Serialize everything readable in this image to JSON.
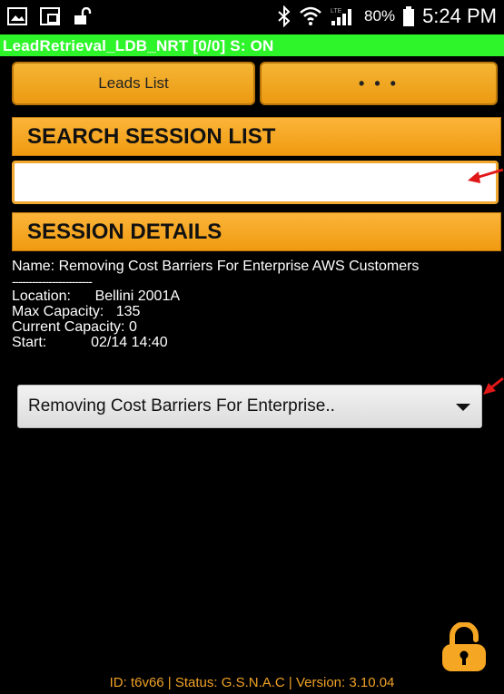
{
  "status_bar": {
    "left_icons": [
      "gallery-icon",
      "screenshot-icon",
      "unlock-icon"
    ],
    "right_icons": [
      "bluetooth-icon",
      "wifi-icon",
      "signal-icon",
      "battery-icon"
    ],
    "battery": "80%",
    "time": "5:24 PM"
  },
  "app": {
    "title": "LeadRetrieval_LDB_NRT [0/0] S: ON",
    "accent": "#2ef52a",
    "orange": "#f5a623"
  },
  "toolbar": {
    "leads_label": "Leads List",
    "more_label": "• • •"
  },
  "search": {
    "header": "SEARCH SESSION LIST",
    "value": "",
    "placeholder": ""
  },
  "session": {
    "header": "SESSION DETAILS",
    "name_line": "Name: Removing Cost Barriers For Enterprise AWS Customers",
    "separator": "------------------------",
    "location": "Location:      Bellini 2001A",
    "max_capacity": "Max Capacity:   135",
    "current_capacity": "Current Capacity: 0",
    "start": "Start:           02/14 14:40",
    "dropdown_selected": "Removing Cost Barriers For Enterprise.."
  },
  "lock_icon": "unlocked-padlock-icon",
  "footer": "ID: t6v66 | Status: G.S.N.A.C | Version: 3.10.04"
}
